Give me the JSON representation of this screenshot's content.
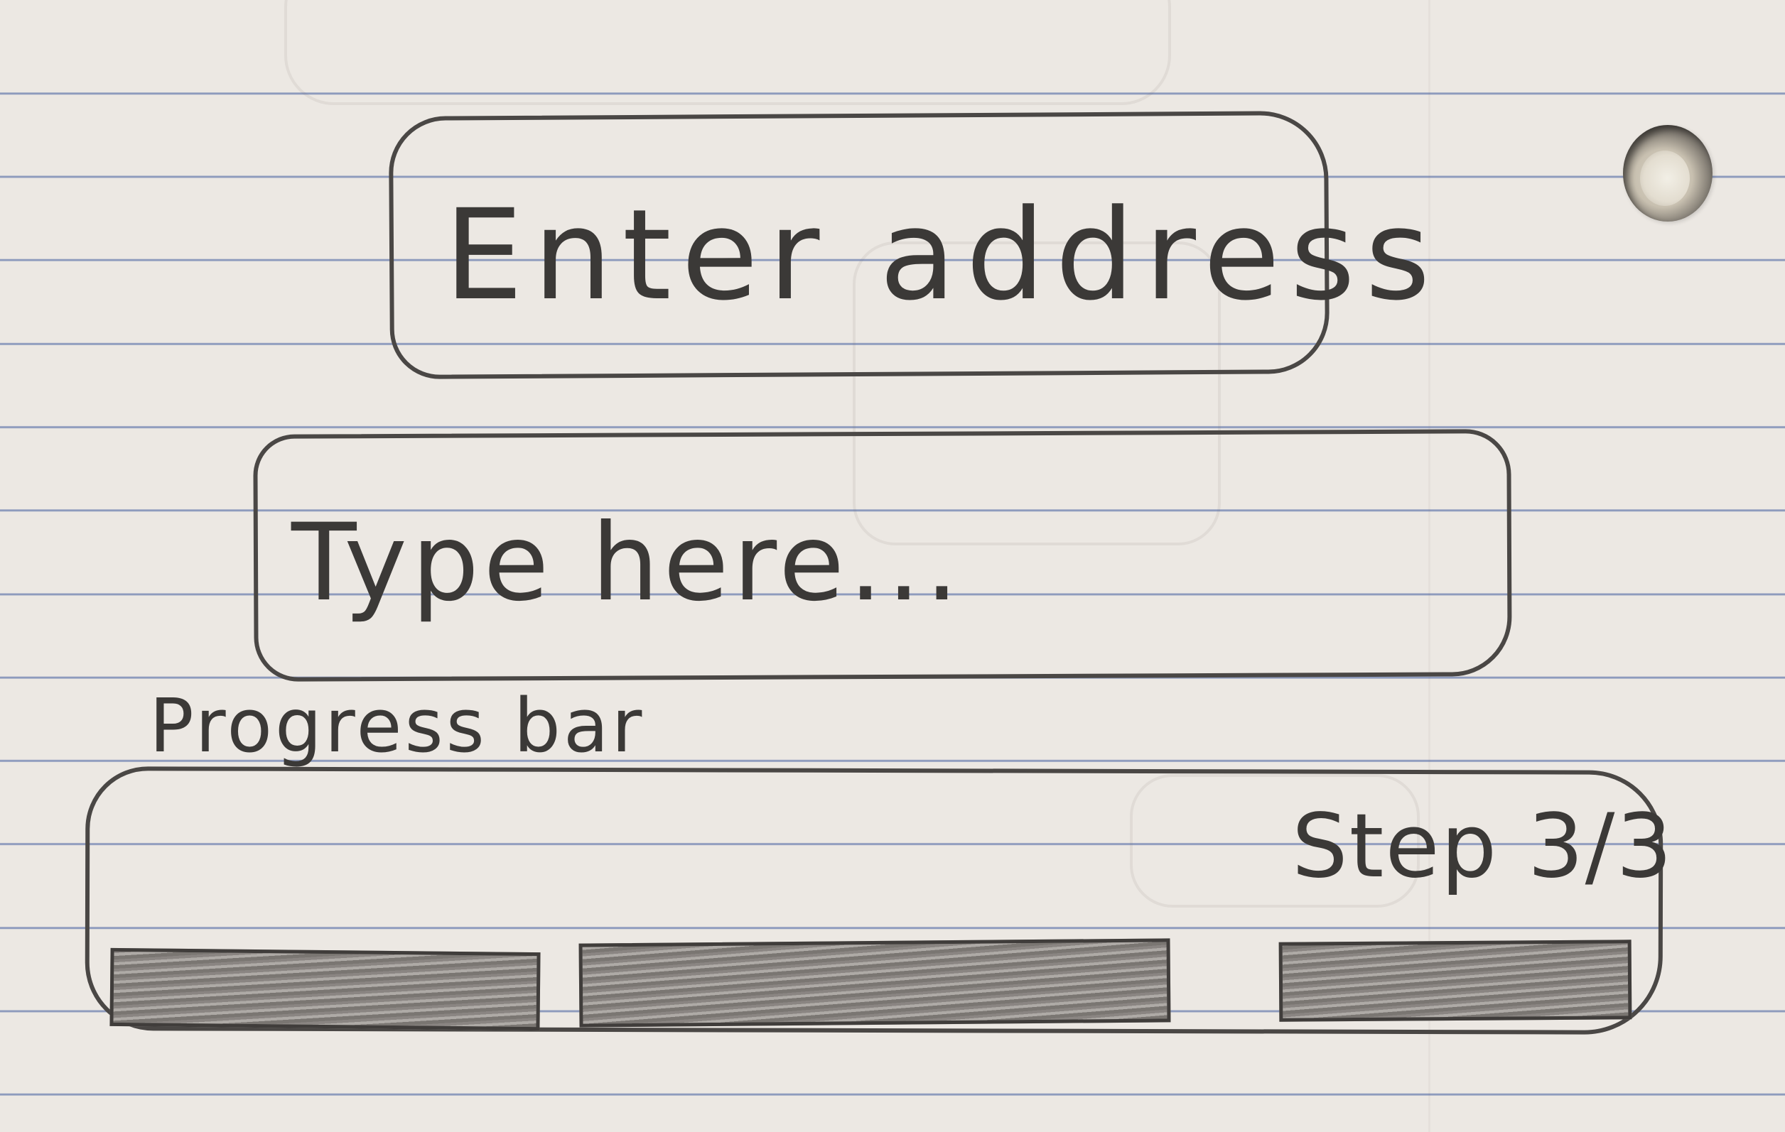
{
  "title": "Enter address",
  "input": {
    "placeholder": "Type here..."
  },
  "progress": {
    "label": "Progress bar",
    "step_text": "Step 3/3",
    "current_step": 3,
    "total_steps": 3
  }
}
